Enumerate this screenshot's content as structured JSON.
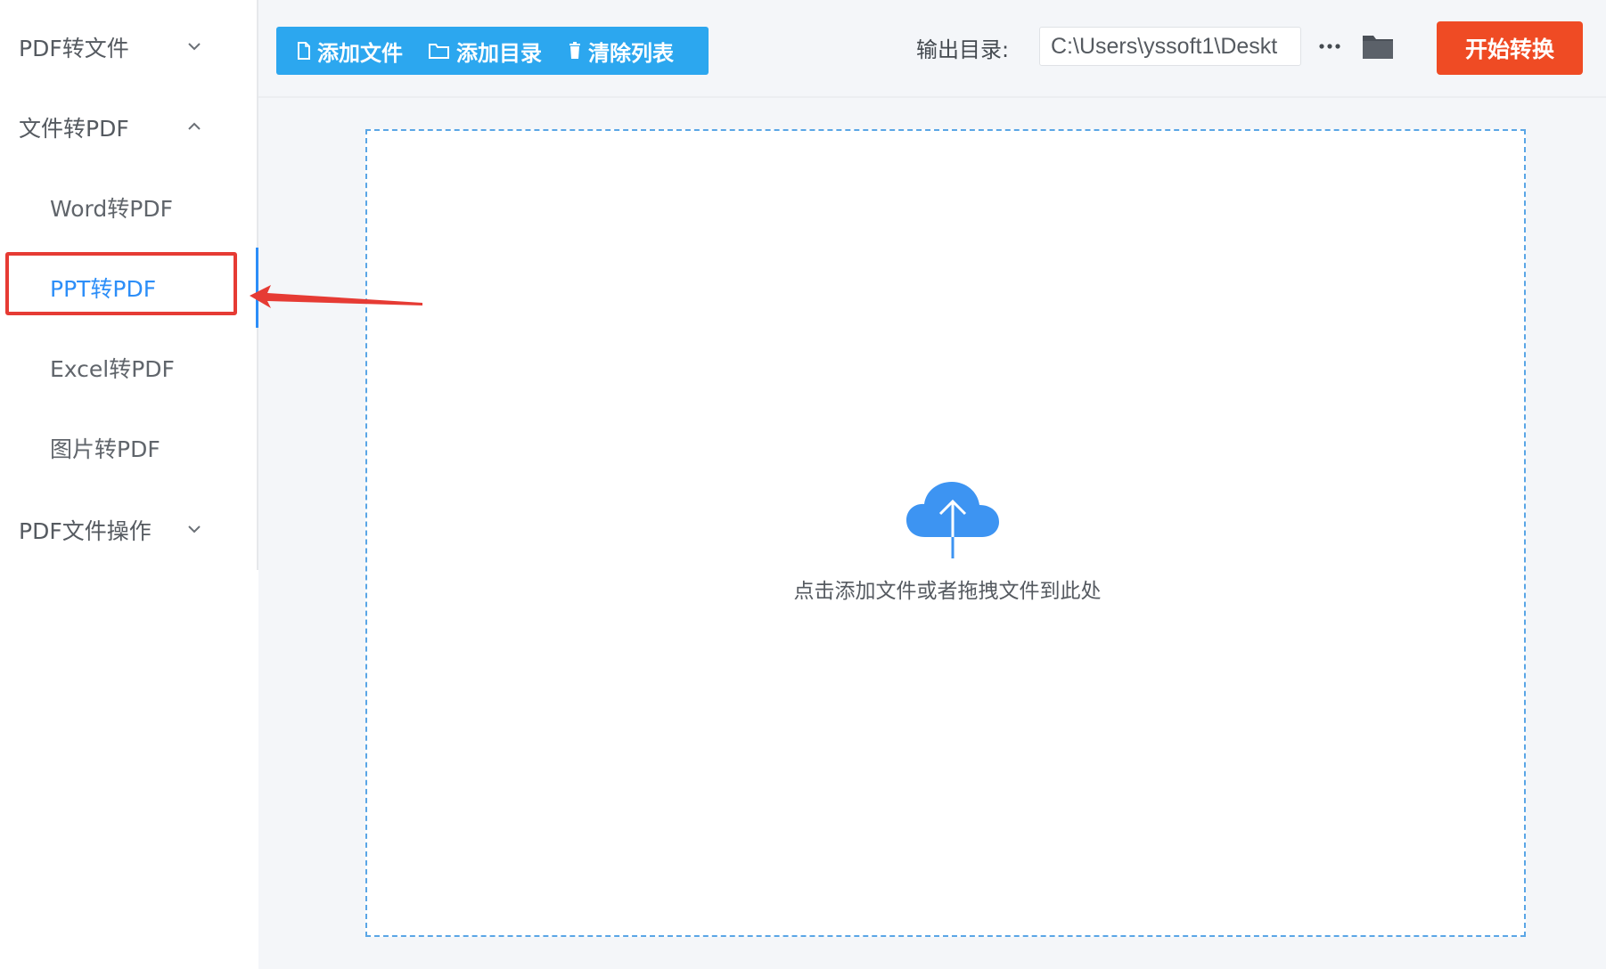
{
  "sidebar": {
    "groups": [
      {
        "label": "PDF转文件",
        "expanded": false
      },
      {
        "label": "文件转PDF",
        "expanded": true
      },
      {
        "label": "PDF文件操作",
        "expanded": false
      }
    ],
    "sub_items": [
      {
        "label": "Word转PDF",
        "active": false
      },
      {
        "label": "PPT转PDF",
        "active": true
      },
      {
        "label": "Excel转PDF",
        "active": false
      },
      {
        "label": "图片转PDF",
        "active": false
      }
    ]
  },
  "toolbar": {
    "add_file_label": "添加文件",
    "add_folder_label": "添加目录",
    "clear_list_label": "清除列表",
    "output_label": "输出目录:",
    "output_path": "C:\\Users\\yssoft1\\Deskt",
    "start_label": "开始转换"
  },
  "dropzone": {
    "hint": "点击添加文件或者拖拽文件到此处"
  },
  "colors": {
    "accent_blue": "#2c8ef8",
    "toolbar_button_blue": "#2ca7ef",
    "start_button_orange": "#ef4b24",
    "annotation_red": "#e63b34"
  },
  "icons": {
    "add_file": "file-icon",
    "add_folder": "folder-outline-icon",
    "clear_list": "trash-icon",
    "more": "ellipsis-icon",
    "open_folder": "folder-icon",
    "upload": "cloud-upload-icon",
    "group_collapsed": "chevron-down-icon",
    "group_expanded": "chevron-up-icon"
  }
}
